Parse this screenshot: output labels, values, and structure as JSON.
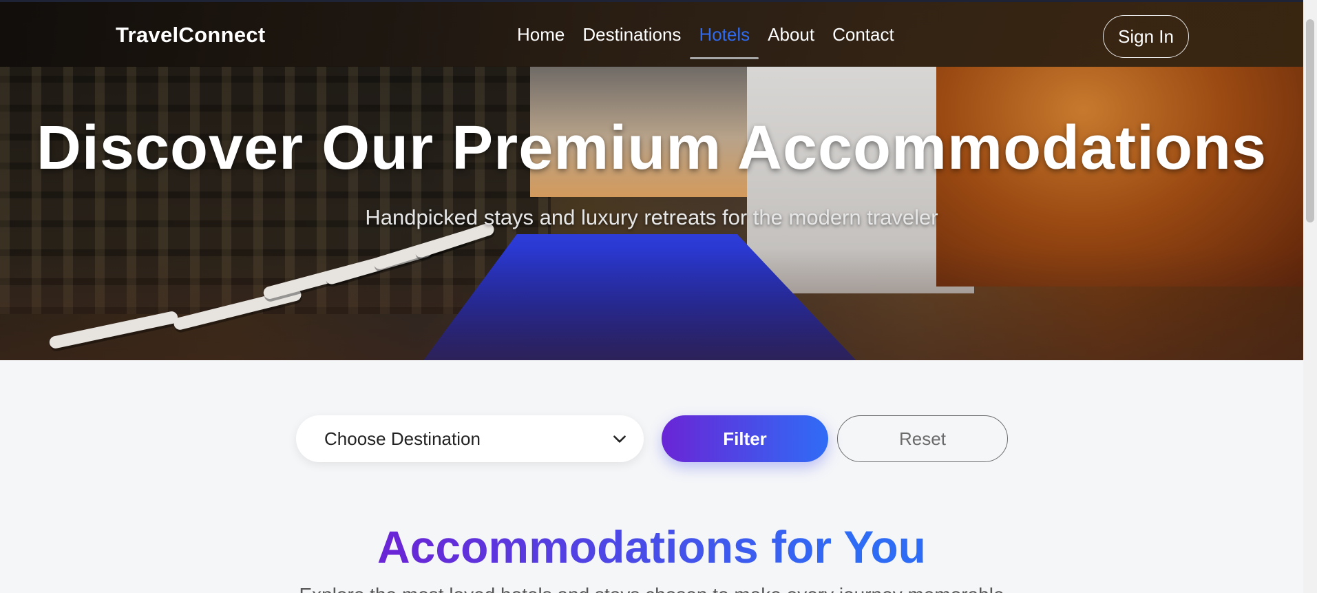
{
  "nav": {
    "brand": "TravelConnect",
    "links": [
      {
        "label": "Home"
      },
      {
        "label": "Destinations"
      },
      {
        "label": "Hotels",
        "active": true
      },
      {
        "label": "About"
      },
      {
        "label": "Contact"
      }
    ],
    "signin_label": "Sign In"
  },
  "hero": {
    "title": "Discover Our Premium Accommodations",
    "subtitle": "Handpicked stays and luxury retreats for the modern traveler"
  },
  "filters": {
    "destination_selected": "Choose Destination",
    "filter_label": "Filter",
    "reset_label": "Reset"
  },
  "section": {
    "title": "Accommodations for You",
    "subtitle": "Explore the most loved hotels and stays chosen to make every journey memorable"
  },
  "colors": {
    "accent_blue": "#2f6bf0",
    "gradient_start": "#6a25d6",
    "gradient_end": "#2f6cf6"
  },
  "icons": {
    "select_caret": "chevron-down-icon"
  }
}
